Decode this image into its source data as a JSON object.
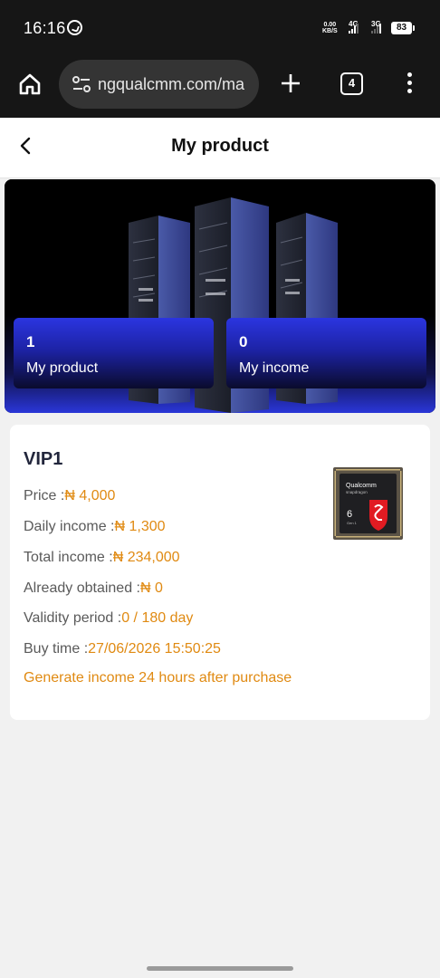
{
  "status_bar": {
    "time": "16:16",
    "net_speed_value": "0.00",
    "net_speed_unit": "KB/S",
    "signal1": "4G",
    "signal2": "3G",
    "battery": "83"
  },
  "browser": {
    "url": "ngqualcmm.com/ma",
    "tab_count": "4"
  },
  "header": {
    "title": "My product"
  },
  "banner": {
    "my_product_value": "1",
    "my_product_label": "My product",
    "my_income_value": "0",
    "my_income_label": "My income"
  },
  "product": {
    "name": "VIP1",
    "price_label": "Price :",
    "price_value": "₦ 4,000",
    "daily_label": "Daily income :",
    "daily_value": "₦ 1,300",
    "total_label": "Total income :",
    "total_value": "₦ 234,000",
    "obtained_label": "Already obtained :",
    "obtained_value": "₦ 0",
    "validity_label": "Validity period :",
    "validity_value": "0 / 180 day",
    "buy_time_label": "Buy time :",
    "buy_time_value": "27/06/2026 15:50:25",
    "note": "Generate income 24 hours after purchase",
    "chip_brand": "Qualcomm",
    "chip_sub": "snapdragon",
    "chip_num": "6",
    "chip_gen": "Gen 1"
  },
  "colors": {
    "accent_orange": "#e08a12",
    "stat_blue": "#2b35e0",
    "chrome_dark": "#161616"
  }
}
